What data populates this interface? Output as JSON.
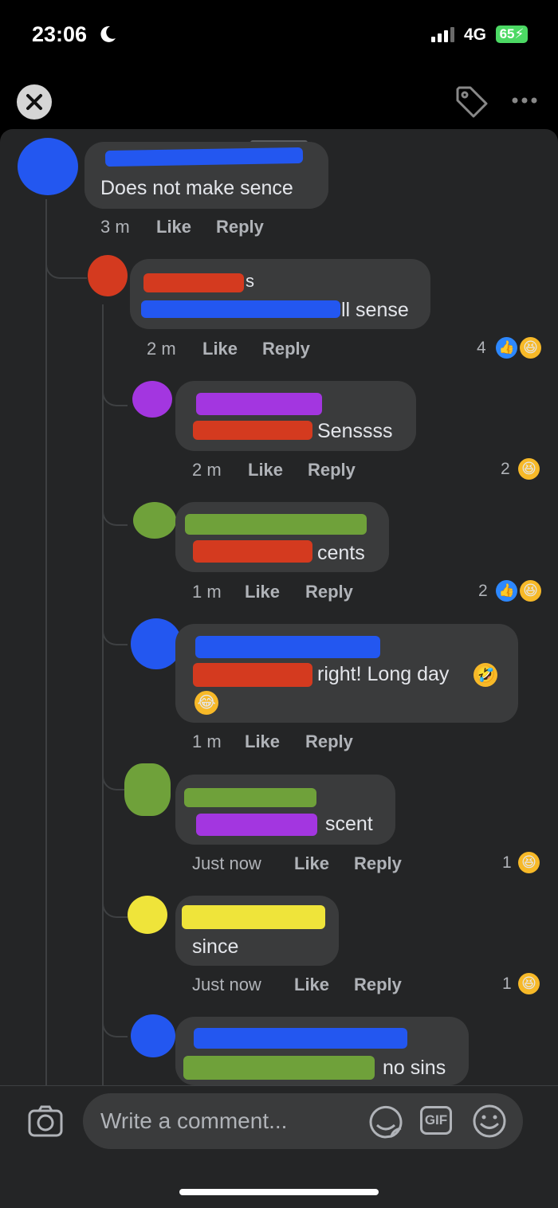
{
  "status": {
    "time": "23:06",
    "network": "4G",
    "battery": "65"
  },
  "comments": [
    {
      "text": "Does not make sence",
      "time": "3 m",
      "like": "Like",
      "reply": "Reply"
    },
    {
      "line1_suffix": "s",
      "text": "ll sense",
      "time": "2 m",
      "like": "Like",
      "reply": "Reply",
      "reactions": "4"
    },
    {
      "text": "Senssss",
      "time": "2 m",
      "like": "Like",
      "reply": "Reply",
      "reactions": "2"
    },
    {
      "text": "cents",
      "time": "1 m",
      "like": "Like",
      "reply": "Reply",
      "reactions": "2"
    },
    {
      "text": "right! Long day",
      "time": "1 m",
      "like": "Like",
      "reply": "Reply"
    },
    {
      "text": "scent",
      "time": "Just now",
      "like": "Like",
      "reply": "Reply",
      "reactions": "1"
    },
    {
      "text": "since",
      "time": "Just now",
      "like": "Like",
      "reply": "Reply",
      "reactions": "1"
    },
    {
      "text": "no sins"
    }
  ],
  "composer": {
    "placeholder": "Write a comment..."
  },
  "icons": {
    "close": "close-icon",
    "tag": "tag-icon",
    "more": "more-icon",
    "camera": "camera-icon",
    "sticker": "sticker-icon",
    "gif": "gif-icon",
    "emoji": "emoji-icon"
  },
  "colors": {
    "background": "#242526",
    "bubble": "#3a3b3c",
    "like_blue": "#2d88ff",
    "haha_yellow": "#f7b928"
  }
}
